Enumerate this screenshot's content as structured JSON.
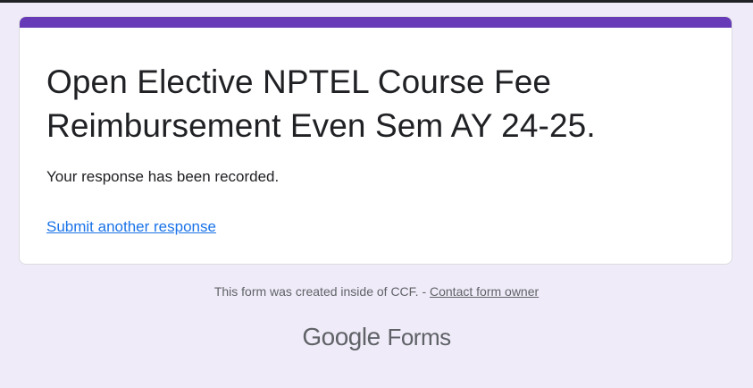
{
  "form": {
    "title": "Open Elective NPTEL Course Fee Reimbursement Even Sem AY 24-25.",
    "confirmation_message": "Your response has been recorded.",
    "submit_another_label": "Submit another response",
    "accent_color": "#673ab7"
  },
  "footer": {
    "created_inside_text": "This form was created inside of CCF. - ",
    "contact_owner_label": "Contact form owner"
  },
  "branding": {
    "google_text": "Google",
    "forms_text": "Forms"
  },
  "colors": {
    "page_background": "#f0ebf8",
    "link": "#1a73e8",
    "text": "#202124",
    "muted": "#5f6368"
  }
}
